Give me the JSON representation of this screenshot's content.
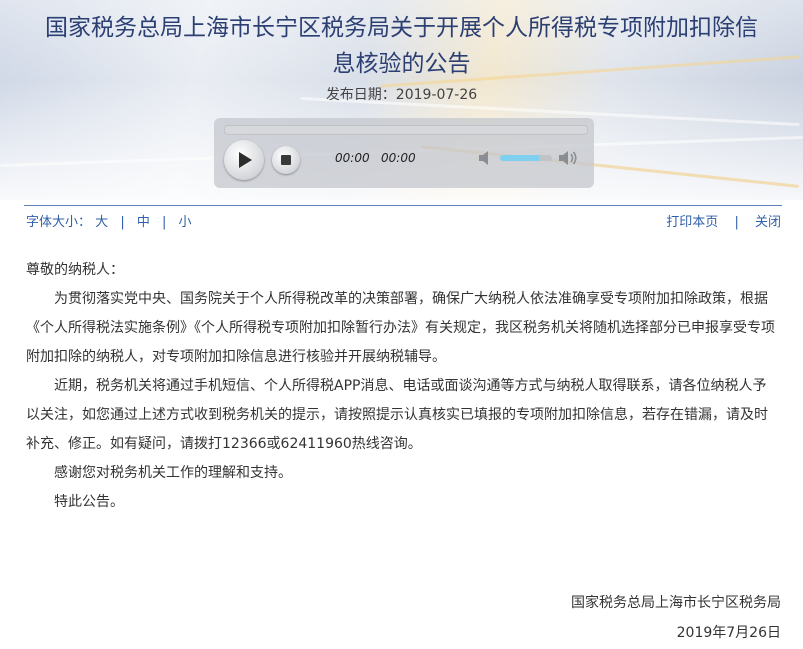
{
  "title_line1": "国家税务总局上海市长宁区税务局关于开展个人所得税专项附加扣除信",
  "title_line2": "息核验的公告",
  "publish_date": "发布日期：2019-07-26",
  "player": {
    "current_time": "00:00",
    "duration": "00:00",
    "progress": 0.0,
    "volume": 0.75
  },
  "font_size": {
    "label": "字体大小：",
    "large": "大",
    "medium": "中",
    "small": "小"
  },
  "tools": {
    "print": "打印本页",
    "close": "关闭"
  },
  "body": {
    "greeting": "尊敬的纳税人：",
    "paragraphs": [
      "为贯彻落实党中央、国务院关于个人所得税改革的决策部署，确保广大纳税人依法准确享受专项附加扣除政策，根据《个人所得税法实施条例》《个人所得税专项附加扣除暂行办法》有关规定，我区税务机关将随机选择部分已申报享受专项附加扣除的纳税人，对专项附加扣除信息进行核验并开展纳税辅导。",
      "近期，税务机关将通过手机短信、个人所得税APP消息、电话或面谈沟通等方式与纳税人取得联系，请各位纳税人予以关注，如您通过上述方式收到税务机关的提示，请按照提示认真核实已填报的专项附加扣除信息，若存在错漏，请及时补充、修正。如有疑问，请拨打12366或62411960热线咨询。",
      "感谢您对税务机关工作的理解和支持。",
      "特此公告。"
    ]
  },
  "signature": {
    "org": "国家税务总局上海市长宁区税务局",
    "date": "2019年7月26日"
  }
}
